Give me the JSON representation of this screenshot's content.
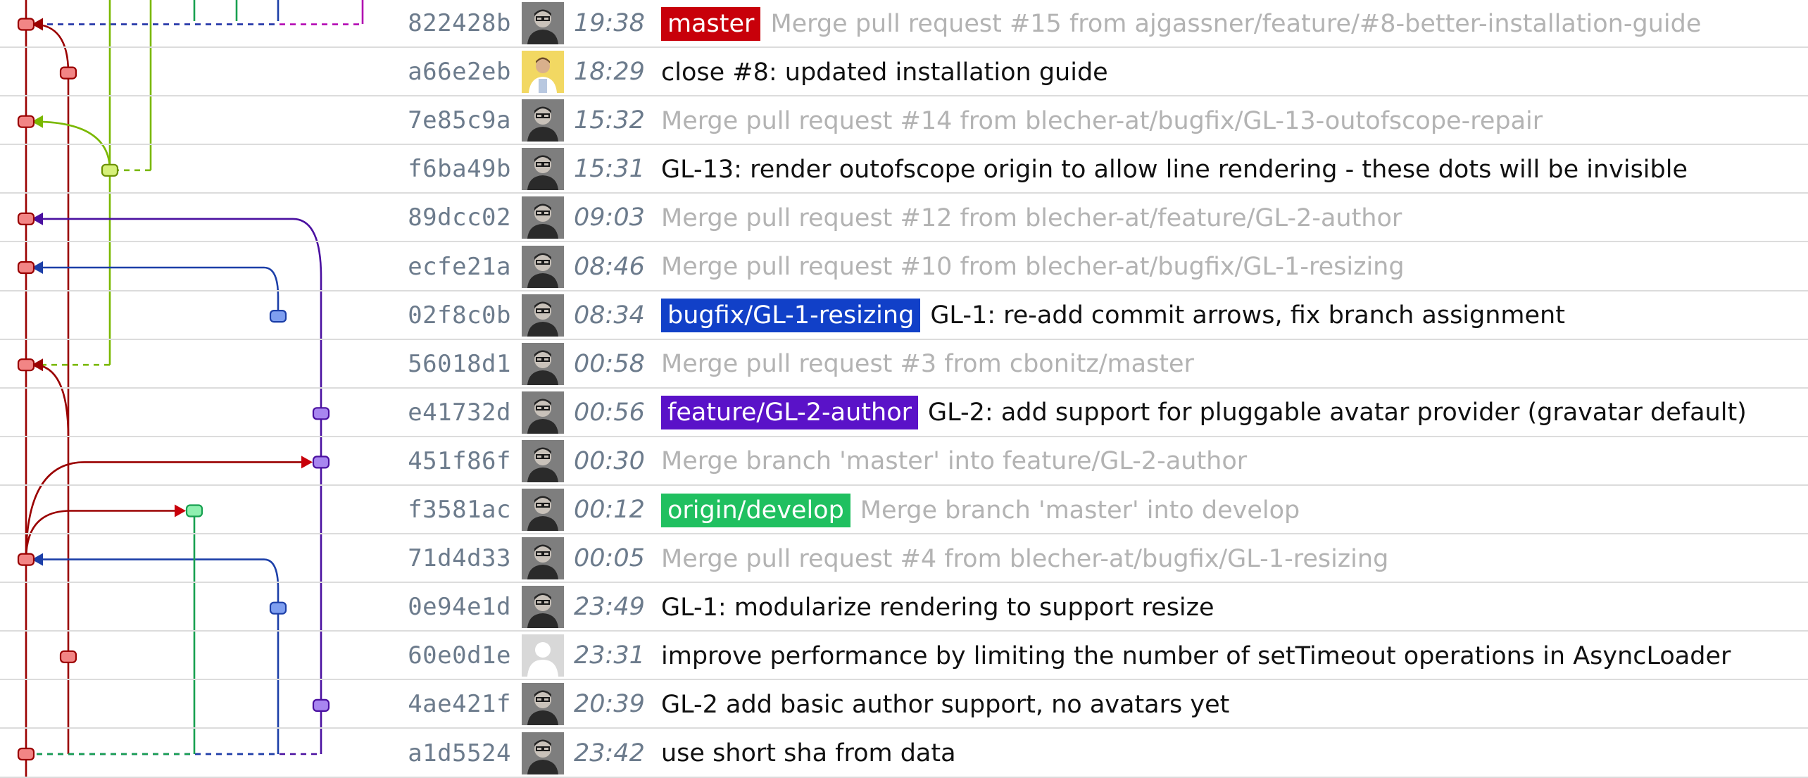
{
  "colors": {
    "master": "#c8000a",
    "bugfix": "#1140c8",
    "feature": "#5a12c8",
    "develop": "#20c060",
    "lime": "#7ab800",
    "red_lane": "#9a0000",
    "blue_lane": "#1c3fa8",
    "purple_lane": "#4a10a0",
    "green_lane": "#17a050",
    "magenta_lane": "#b000b0"
  },
  "commits": [
    {
      "sha": "822428b",
      "time": "19:38",
      "avatar": "person-photo-icon",
      "badge": {
        "label": "master",
        "color": "#c8000a"
      },
      "message": "Merge pull request #15 from ajgassner/feature/#8-better-installation-guide",
      "is_merge": true
    },
    {
      "sha": "a66e2eb",
      "time": "18:29",
      "avatar": "person-yellow-photo-icon",
      "badge": null,
      "message": "close #8: updated installation guide",
      "is_merge": false
    },
    {
      "sha": "7e85c9a",
      "time": "15:32",
      "avatar": "person-photo-icon",
      "badge": null,
      "message": "Merge pull request #14 from blecher-at/bugfix/GL-13-outofscope-repair",
      "is_merge": true
    },
    {
      "sha": "f6ba49b",
      "time": "15:31",
      "avatar": "person-photo-icon",
      "badge": null,
      "message": "GL-13: render outofscope origin to allow line rendering - these dots will be invisible",
      "is_merge": false
    },
    {
      "sha": "89dcc02",
      "time": "09:03",
      "avatar": "person-photo-icon",
      "badge": null,
      "message": "Merge pull request #12 from blecher-at/feature/GL-2-author",
      "is_merge": true
    },
    {
      "sha": "ecfe21a",
      "time": "08:46",
      "avatar": "person-photo-icon",
      "badge": null,
      "message": "Merge pull request #10 from blecher-at/bugfix/GL-1-resizing",
      "is_merge": true
    },
    {
      "sha": "02f8c0b",
      "time": "08:34",
      "avatar": "person-photo-icon",
      "badge": {
        "label": "bugfix/GL-1-resizing",
        "color": "#1140c8"
      },
      "message": "GL-1: re-add commit arrows, fix branch assignment",
      "is_merge": false
    },
    {
      "sha": "56018d1",
      "time": "00:58",
      "avatar": "person-photo-icon",
      "badge": null,
      "message": "Merge pull request #3 from cbonitz/master",
      "is_merge": true
    },
    {
      "sha": "e41732d",
      "time": "00:56",
      "avatar": "person-photo-icon",
      "badge": {
        "label": "feature/GL-2-author",
        "color": "#5a12c8"
      },
      "message": "GL-2: add support for pluggable avatar provider (gravatar default)",
      "is_merge": false
    },
    {
      "sha": "451f86f",
      "time": "00:30",
      "avatar": "person-photo-icon",
      "badge": null,
      "message": "Merge branch 'master' into feature/GL-2-author",
      "is_merge": true
    },
    {
      "sha": "f3581ac",
      "time": "00:12",
      "avatar": "person-photo-icon",
      "badge": {
        "label": "origin/develop",
        "color": "#20c060"
      },
      "message": "Merge branch 'master' into develop",
      "is_merge": true
    },
    {
      "sha": "71d4d33",
      "time": "00:05",
      "avatar": "person-photo-icon",
      "badge": null,
      "message": "Merge pull request #4 from blecher-at/bugfix/GL-1-resizing",
      "is_merge": true
    },
    {
      "sha": "0e94e1d",
      "time": "23:49",
      "avatar": "person-photo-icon",
      "badge": null,
      "message": "GL-1: modularize rendering to support resize",
      "is_merge": false
    },
    {
      "sha": "60e0d1e",
      "time": "23:31",
      "avatar": "default-avatar-icon",
      "badge": null,
      "message": "improve performance by limiting the number of setTimeout operations in AsyncLoader",
      "is_merge": false
    },
    {
      "sha": "4ae421f",
      "time": "20:39",
      "avatar": "person-photo-icon",
      "badge": null,
      "message": "GL-2 add basic author support, no avatars yet",
      "is_merge": false
    },
    {
      "sha": "a1d5524",
      "time": "23:42",
      "avatar": "person-photo-icon",
      "badge": null,
      "message": "use short sha from data",
      "is_merge": false
    }
  ]
}
